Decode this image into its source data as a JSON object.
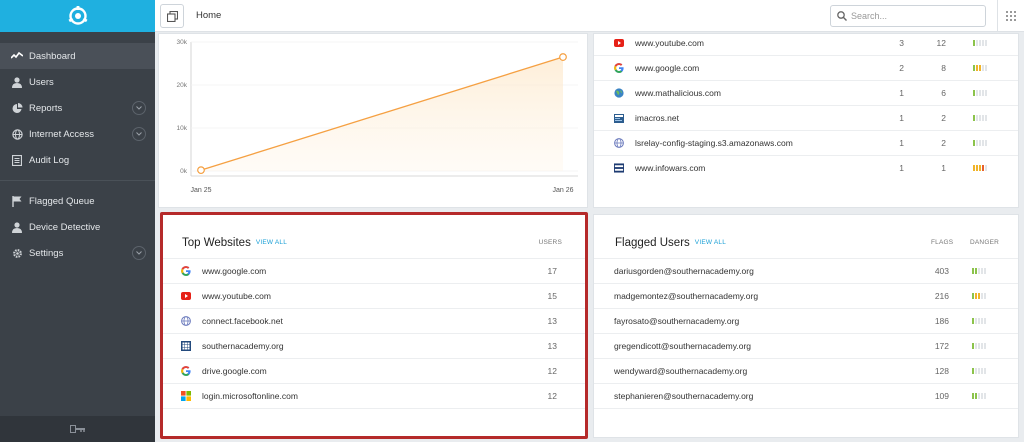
{
  "sidebar": {
    "items": [
      {
        "label": "Dashboard",
        "icon": "activity-icon"
      },
      {
        "label": "Users",
        "icon": "user-icon"
      },
      {
        "label": "Reports",
        "icon": "pie-chart-icon"
      },
      {
        "label": "Internet Access",
        "icon": "globe-icon"
      },
      {
        "label": "Audit Log",
        "icon": "list-icon"
      },
      {
        "label": "Flagged Queue",
        "icon": "flag-icon"
      },
      {
        "label": "Device Detective",
        "icon": "user-icon"
      },
      {
        "label": "Settings",
        "icon": "gear-icon"
      }
    ]
  },
  "topbar": {
    "breadcrumb": "Home",
    "search_placeholder": "Search..."
  },
  "chart_data": {
    "type": "line",
    "x": [
      "Jan 25",
      "Jan 26"
    ],
    "series": [
      {
        "values": [
          200,
          26500
        ]
      }
    ],
    "y_ticks": [
      "30k",
      "20k",
      "10k",
      "0k"
    ],
    "ylim": [
      0,
      30000
    ],
    "color": "#f5a042"
  },
  "top_right_list": [
    {
      "name": "www.youtube.com",
      "icon": "youtube-icon",
      "a": "3",
      "b": "12",
      "danger": 1
    },
    {
      "name": "www.google.com",
      "icon": "google-icon",
      "a": "2",
      "b": "8",
      "danger": 3
    },
    {
      "name": "www.mathalicious.com",
      "icon": "globe-icon",
      "a": "1",
      "b": "6",
      "danger": 1
    },
    {
      "name": "imacros.net",
      "icon": "imacros-icon",
      "a": "1",
      "b": "2",
      "danger": 1
    },
    {
      "name": "lsrelay-config-staging.s3.amazonaws.com",
      "icon": "web-icon",
      "a": "1",
      "b": "2",
      "danger": 1
    },
    {
      "name": "www.infowars.com",
      "icon": "infowars-icon",
      "a": "1",
      "b": "1",
      "danger": 4
    }
  ],
  "top_websites": {
    "title": "Top Websites",
    "view_all": "VIEW ALL",
    "col_users": "USERS",
    "rows": [
      {
        "name": "www.google.com",
        "icon": "google-icon",
        "users": "17"
      },
      {
        "name": "www.youtube.com",
        "icon": "youtube-icon",
        "users": "15"
      },
      {
        "name": "connect.facebook.net",
        "icon": "web-icon",
        "users": "13"
      },
      {
        "name": "southernacademy.org",
        "icon": "building-icon",
        "users": "13"
      },
      {
        "name": "drive.google.com",
        "icon": "google-icon",
        "users": "12"
      },
      {
        "name": "login.microsoftonline.com",
        "icon": "microsoft-icon",
        "users": "12"
      }
    ]
  },
  "flagged_users": {
    "title": "Flagged Users",
    "view_all": "VIEW ALL",
    "col_flags": "FLAGS",
    "col_danger": "DANGER",
    "rows": [
      {
        "email": "dariusgorden@southernacademy.org",
        "flags": "403",
        "danger": 2
      },
      {
        "email": "madgemontez@southernacademy.org",
        "flags": "216",
        "danger": 3
      },
      {
        "email": "fayrosato@southernacademy.org",
        "flags": "186",
        "danger": 1
      },
      {
        "email": "gregendicott@southernacademy.org",
        "flags": "172",
        "danger": 1
      },
      {
        "email": "wendyward@southernacademy.org",
        "flags": "128",
        "danger": 1
      },
      {
        "email": "stephanieren@southernacademy.org",
        "flags": "109",
        "danger": 2
      }
    ]
  },
  "colors": {
    "accent": "#1fb0e0",
    "sidebar": "#3b4148",
    "highlight": "#b52a2a",
    "danger_low": "#8bc34a",
    "danger_mid": "#f0b429",
    "danger_high": "#e8612c"
  }
}
